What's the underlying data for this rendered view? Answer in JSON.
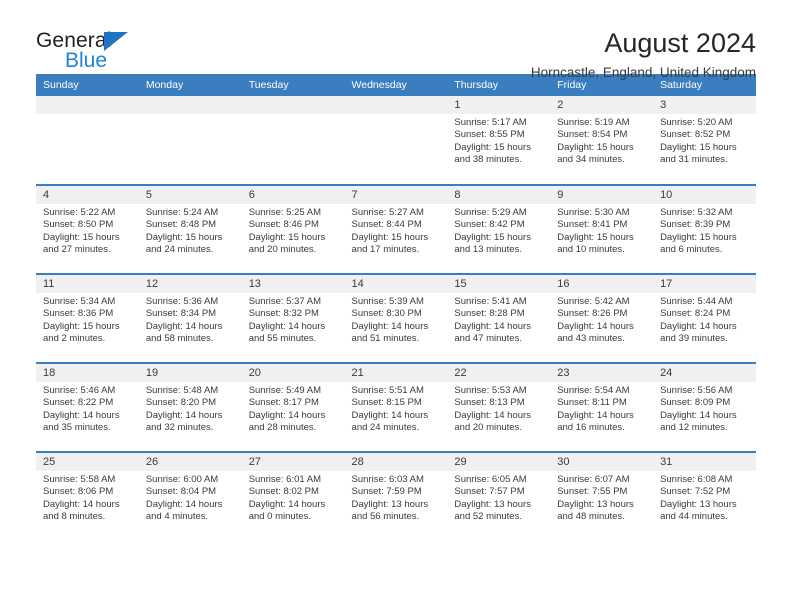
{
  "brand": {
    "name_top": "General",
    "name_bottom": "Blue",
    "accent_color": "#1f84d6",
    "triangle_color": "#1f73c0"
  },
  "header": {
    "title": "August 2024",
    "subtitle": "Horncastle, England, United Kingdom"
  },
  "theme": {
    "header_band": "#3a7ebf",
    "day_band": "#f0f0f0",
    "text": "#3b3b3b"
  },
  "weekdays": [
    "Sunday",
    "Monday",
    "Tuesday",
    "Wednesday",
    "Thursday",
    "Friday",
    "Saturday"
  ],
  "weeks": [
    [
      {
        "day": "",
        "sunrise": "",
        "sunset": "",
        "daylight_line1": "",
        "daylight_line2": ""
      },
      {
        "day": "",
        "sunrise": "",
        "sunset": "",
        "daylight_line1": "",
        "daylight_line2": ""
      },
      {
        "day": "",
        "sunrise": "",
        "sunset": "",
        "daylight_line1": "",
        "daylight_line2": ""
      },
      {
        "day": "",
        "sunrise": "",
        "sunset": "",
        "daylight_line1": "",
        "daylight_line2": ""
      },
      {
        "day": "1",
        "sunrise": "Sunrise: 5:17 AM",
        "sunset": "Sunset: 8:55 PM",
        "daylight_line1": "Daylight: 15 hours",
        "daylight_line2": "and 38 minutes."
      },
      {
        "day": "2",
        "sunrise": "Sunrise: 5:19 AM",
        "sunset": "Sunset: 8:54 PM",
        "daylight_line1": "Daylight: 15 hours",
        "daylight_line2": "and 34 minutes."
      },
      {
        "day": "3",
        "sunrise": "Sunrise: 5:20 AM",
        "sunset": "Sunset: 8:52 PM",
        "daylight_line1": "Daylight: 15 hours",
        "daylight_line2": "and 31 minutes."
      }
    ],
    [
      {
        "day": "4",
        "sunrise": "Sunrise: 5:22 AM",
        "sunset": "Sunset: 8:50 PM",
        "daylight_line1": "Daylight: 15 hours",
        "daylight_line2": "and 27 minutes."
      },
      {
        "day": "5",
        "sunrise": "Sunrise: 5:24 AM",
        "sunset": "Sunset: 8:48 PM",
        "daylight_line1": "Daylight: 15 hours",
        "daylight_line2": "and 24 minutes."
      },
      {
        "day": "6",
        "sunrise": "Sunrise: 5:25 AM",
        "sunset": "Sunset: 8:46 PM",
        "daylight_line1": "Daylight: 15 hours",
        "daylight_line2": "and 20 minutes."
      },
      {
        "day": "7",
        "sunrise": "Sunrise: 5:27 AM",
        "sunset": "Sunset: 8:44 PM",
        "daylight_line1": "Daylight: 15 hours",
        "daylight_line2": "and 17 minutes."
      },
      {
        "day": "8",
        "sunrise": "Sunrise: 5:29 AM",
        "sunset": "Sunset: 8:42 PM",
        "daylight_line1": "Daylight: 15 hours",
        "daylight_line2": "and 13 minutes."
      },
      {
        "day": "9",
        "sunrise": "Sunrise: 5:30 AM",
        "sunset": "Sunset: 8:41 PM",
        "daylight_line1": "Daylight: 15 hours",
        "daylight_line2": "and 10 minutes."
      },
      {
        "day": "10",
        "sunrise": "Sunrise: 5:32 AM",
        "sunset": "Sunset: 8:39 PM",
        "daylight_line1": "Daylight: 15 hours",
        "daylight_line2": "and 6 minutes."
      }
    ],
    [
      {
        "day": "11",
        "sunrise": "Sunrise: 5:34 AM",
        "sunset": "Sunset: 8:36 PM",
        "daylight_line1": "Daylight: 15 hours",
        "daylight_line2": "and 2 minutes."
      },
      {
        "day": "12",
        "sunrise": "Sunrise: 5:36 AM",
        "sunset": "Sunset: 8:34 PM",
        "daylight_line1": "Daylight: 14 hours",
        "daylight_line2": "and 58 minutes."
      },
      {
        "day": "13",
        "sunrise": "Sunrise: 5:37 AM",
        "sunset": "Sunset: 8:32 PM",
        "daylight_line1": "Daylight: 14 hours",
        "daylight_line2": "and 55 minutes."
      },
      {
        "day": "14",
        "sunrise": "Sunrise: 5:39 AM",
        "sunset": "Sunset: 8:30 PM",
        "daylight_line1": "Daylight: 14 hours",
        "daylight_line2": "and 51 minutes."
      },
      {
        "day": "15",
        "sunrise": "Sunrise: 5:41 AM",
        "sunset": "Sunset: 8:28 PM",
        "daylight_line1": "Daylight: 14 hours",
        "daylight_line2": "and 47 minutes."
      },
      {
        "day": "16",
        "sunrise": "Sunrise: 5:42 AM",
        "sunset": "Sunset: 8:26 PM",
        "daylight_line1": "Daylight: 14 hours",
        "daylight_line2": "and 43 minutes."
      },
      {
        "day": "17",
        "sunrise": "Sunrise: 5:44 AM",
        "sunset": "Sunset: 8:24 PM",
        "daylight_line1": "Daylight: 14 hours",
        "daylight_line2": "and 39 minutes."
      }
    ],
    [
      {
        "day": "18",
        "sunrise": "Sunrise: 5:46 AM",
        "sunset": "Sunset: 8:22 PM",
        "daylight_line1": "Daylight: 14 hours",
        "daylight_line2": "and 35 minutes."
      },
      {
        "day": "19",
        "sunrise": "Sunrise: 5:48 AM",
        "sunset": "Sunset: 8:20 PM",
        "daylight_line1": "Daylight: 14 hours",
        "daylight_line2": "and 32 minutes."
      },
      {
        "day": "20",
        "sunrise": "Sunrise: 5:49 AM",
        "sunset": "Sunset: 8:17 PM",
        "daylight_line1": "Daylight: 14 hours",
        "daylight_line2": "and 28 minutes."
      },
      {
        "day": "21",
        "sunrise": "Sunrise: 5:51 AM",
        "sunset": "Sunset: 8:15 PM",
        "daylight_line1": "Daylight: 14 hours",
        "daylight_line2": "and 24 minutes."
      },
      {
        "day": "22",
        "sunrise": "Sunrise: 5:53 AM",
        "sunset": "Sunset: 8:13 PM",
        "daylight_line1": "Daylight: 14 hours",
        "daylight_line2": "and 20 minutes."
      },
      {
        "day": "23",
        "sunrise": "Sunrise: 5:54 AM",
        "sunset": "Sunset: 8:11 PM",
        "daylight_line1": "Daylight: 14 hours",
        "daylight_line2": "and 16 minutes."
      },
      {
        "day": "24",
        "sunrise": "Sunrise: 5:56 AM",
        "sunset": "Sunset: 8:09 PM",
        "daylight_line1": "Daylight: 14 hours",
        "daylight_line2": "and 12 minutes."
      }
    ],
    [
      {
        "day": "25",
        "sunrise": "Sunrise: 5:58 AM",
        "sunset": "Sunset: 8:06 PM",
        "daylight_line1": "Daylight: 14 hours",
        "daylight_line2": "and 8 minutes."
      },
      {
        "day": "26",
        "sunrise": "Sunrise: 6:00 AM",
        "sunset": "Sunset: 8:04 PM",
        "daylight_line1": "Daylight: 14 hours",
        "daylight_line2": "and 4 minutes."
      },
      {
        "day": "27",
        "sunrise": "Sunrise: 6:01 AM",
        "sunset": "Sunset: 8:02 PM",
        "daylight_line1": "Daylight: 14 hours",
        "daylight_line2": "and 0 minutes."
      },
      {
        "day": "28",
        "sunrise": "Sunrise: 6:03 AM",
        "sunset": "Sunset: 7:59 PM",
        "daylight_line1": "Daylight: 13 hours",
        "daylight_line2": "and 56 minutes."
      },
      {
        "day": "29",
        "sunrise": "Sunrise: 6:05 AM",
        "sunset": "Sunset: 7:57 PM",
        "daylight_line1": "Daylight: 13 hours",
        "daylight_line2": "and 52 minutes."
      },
      {
        "day": "30",
        "sunrise": "Sunrise: 6:07 AM",
        "sunset": "Sunset: 7:55 PM",
        "daylight_line1": "Daylight: 13 hours",
        "daylight_line2": "and 48 minutes."
      },
      {
        "day": "31",
        "sunrise": "Sunrise: 6:08 AM",
        "sunset": "Sunset: 7:52 PM",
        "daylight_line1": "Daylight: 13 hours",
        "daylight_line2": "and 44 minutes."
      }
    ]
  ]
}
